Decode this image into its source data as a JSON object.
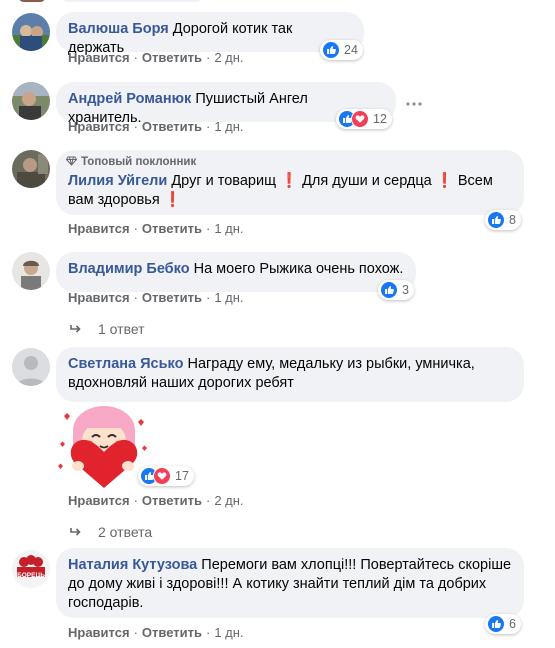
{
  "ui": {
    "like_label": "Нравится",
    "reply_label": "Ответить",
    "separator": "·"
  },
  "comments": [
    {
      "author": "Валюша Боря",
      "text": "Дорогой котик так держать",
      "time": "2 дн.",
      "reactions": "24"
    },
    {
      "author": "Андрей Романюк",
      "text": "Пушистый Ангел хранитель.",
      "time": "1 дн.",
      "reactions": "12"
    },
    {
      "badge": "Топовый поклонник",
      "author": "Лилия Уйгели",
      "text": "Друг и товарищ ❗ Для души и сердца ❗ Всем вам здоровья ❗",
      "time": "1 дн.",
      "reactions": "8"
    },
    {
      "author": "Владимир Бебко",
      "text": "На моего Рыжика очень похож.",
      "time": "1 дн.",
      "reactions": "3",
      "replies": "1 ответ"
    },
    {
      "author": "Светлана Ясько",
      "text": "Награду ему, медальку из рыбки, умничка, вдохновляй наших дорогих ребят",
      "time": "2 дн.",
      "reactions": "17",
      "replies": "2 ответа"
    },
    {
      "author": "Наталия Кутузова",
      "text": "Перемоги вам хлопці!!! Повертайтесь скоріше до дому живі і здорові!!! А котику знайти теплий дім та добрих господарів.",
      "time": "1 дн.",
      "reactions": "6"
    }
  ],
  "avatar_label": "БОРЕЦЬ",
  "icons": [
    "like-icon",
    "love-icon",
    "reply-arrow-icon",
    "diamond-icon",
    "more-dots-icon"
  ],
  "colors": {
    "accent": "#385898",
    "like": "#1877f2",
    "love": "#f33e58",
    "bubble": "#f0f2f5"
  }
}
